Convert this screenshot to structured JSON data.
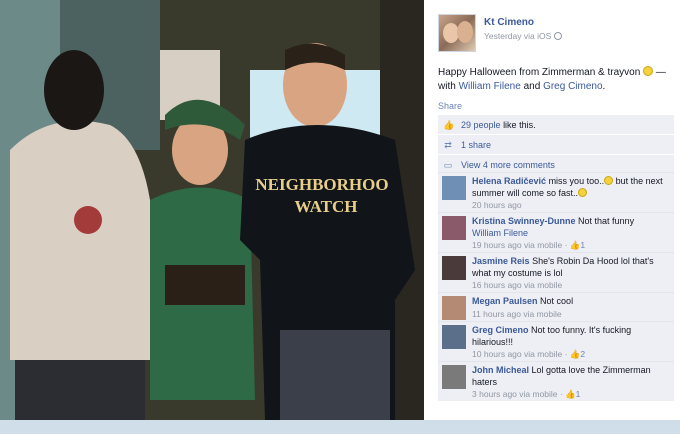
{
  "post": {
    "author": "Kt Cimeno",
    "meta": "Yesterday via iOS",
    "text_main": "Happy Halloween from Zimmerman & trayvon",
    "text_with": "— with",
    "tag1": "William Filene",
    "text_and": "and",
    "tag2": "Greg Cimeno",
    "text_end": ".",
    "share": "Share",
    "shirt_text_line1": "NEIGHBORHOO",
    "shirt_text_line2": "WATCH"
  },
  "ufi": {
    "likes": "29 people",
    "likes_suffix": "like this.",
    "shares": "1 share",
    "view_more": "View 4 more comments"
  },
  "comments": [
    {
      "author": "Helena Radičević",
      "text": "miss you too..",
      "text2": "but the next summer will come so fast..",
      "meta": "20 hours ago",
      "likes": "",
      "avatar_color": "#6f8fb5"
    },
    {
      "author": "Kristina Swinney-Dunne",
      "text": "Not that funny",
      "link": "William Filene",
      "meta": "19 hours ago via mobile · ",
      "likes": "1",
      "avatar_color": "#8a5a6a"
    },
    {
      "author": "Jasmine Reis",
      "text": "She's Robin Da Hood lol that's what my costume is lol",
      "meta": "16 hours ago via mobile",
      "likes": "",
      "avatar_color": "#4a3a3a"
    },
    {
      "author": "Megan Paulsen",
      "text": "Not cool",
      "meta": "11 hours ago via mobile",
      "likes": "",
      "avatar_color": "#b58a75"
    },
    {
      "author": "Greg Cimeno",
      "text": "Not too funny. It's fucking hilarious!!!",
      "meta": "10 hours ago via mobile · ",
      "likes": "2",
      "avatar_color": "#5b6f8a"
    },
    {
      "author": "John Micheal",
      "text": "Lol gotta love the Zimmerman haters",
      "meta": "3 hours ago via mobile · ",
      "likes": "1",
      "avatar_color": "#7a7a7a"
    }
  ]
}
